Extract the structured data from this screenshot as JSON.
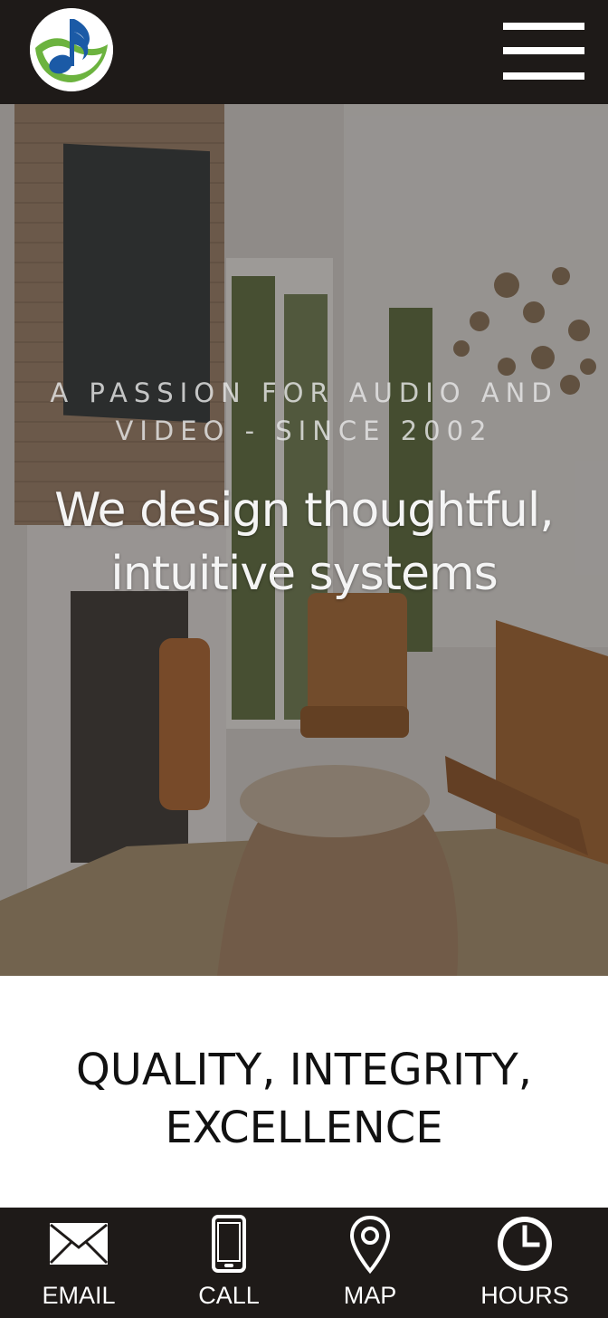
{
  "header": {
    "logo_icon": "music-note-logo-icon",
    "menu_icon": "hamburger-menu-icon"
  },
  "hero": {
    "tagline": "A PASSION FOR AUDIO AND VIDEO - SINCE 2002",
    "headline": "We design thoughtful, intuitive systems"
  },
  "values": {
    "title": "QUALITY, INTEGRITY, EXCELLENCE"
  },
  "bottom_nav": {
    "items": [
      {
        "label": "EMAIL",
        "icon": "envelope-icon"
      },
      {
        "label": "CALL",
        "icon": "phone-icon"
      },
      {
        "label": "MAP",
        "icon": "map-pin-icon"
      },
      {
        "label": "HOURS",
        "icon": "clock-icon"
      }
    ]
  },
  "colors": {
    "header_bg": "#1e1a18",
    "nav_bg": "#1e1a18",
    "logo_green": "#6cb33f",
    "logo_blue": "#1b5aa6"
  }
}
